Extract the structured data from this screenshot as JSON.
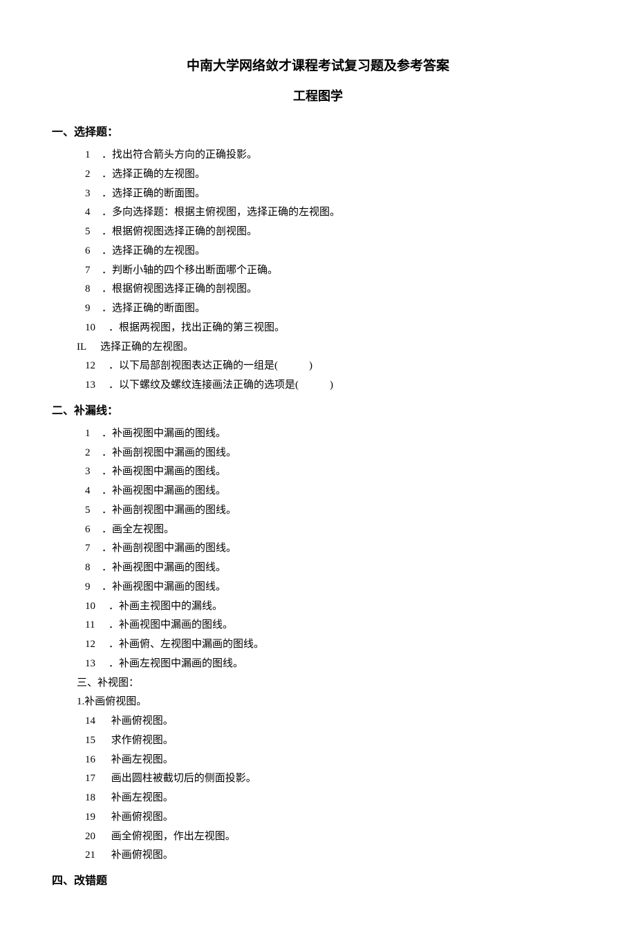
{
  "title": "中南大学网络敛才课程考试复习题及参考答案",
  "subtitle": "工程图学",
  "sections": [
    {
      "header": "一、选择题：",
      "items": [
        {
          "num": "1",
          "text": "．找出符合箭头方向的正确投影。"
        },
        {
          "num": "2",
          "text": "．选择正确的左视图。"
        },
        {
          "num": "3",
          "text": "．选择正确的断面图。"
        },
        {
          "num": "4",
          "text": "．多向选择题：根据主俯视图，选择正确的左视图。"
        },
        {
          "num": "5",
          "text": "．根据俯视图选择正确的剖视图。"
        },
        {
          "num": "6",
          "text": "．选择正确的左视图。"
        },
        {
          "num": "7",
          "text": "．判断小轴的四个移出断面哪个正确。"
        },
        {
          "num": "8",
          "text": "．根据俯视图选择正确的剖视图。"
        },
        {
          "num": "9",
          "text": "．选择正确的断面图。"
        },
        {
          "num": "10",
          "text": "．根据两视图，找出正确的第三视图。"
        },
        {
          "num": "IL",
          "text": "选择正确的左视图。",
          "alt": true
        },
        {
          "num": "12",
          "text": "．以下局部剖视图表达正确的一组是(　　　)"
        },
        {
          "num": "13",
          "text": "．以下螺纹及螺纹连接画法正确的选项是(　　　)"
        }
      ]
    },
    {
      "header": "二、补漏线：",
      "items": [
        {
          "num": "1",
          "text": "．补画视图中漏画的图线。"
        },
        {
          "num": "2",
          "text": "．补画剖视图中漏画的图线。"
        },
        {
          "num": "3",
          "text": "．补画视图中漏画的图线。"
        },
        {
          "num": "4",
          "text": "．补画视图中漏画的图线。"
        },
        {
          "num": "5",
          "text": "．补画剖视图中漏画的图线。"
        },
        {
          "num": "6",
          "text": "．画全左视图。"
        },
        {
          "num": "7",
          "text": "．补画剖视图中漏画的图线。"
        },
        {
          "num": "8",
          "text": "．补画视图中漏画的图线。"
        },
        {
          "num": "9",
          "text": "．补画视图中漏画的图线。"
        },
        {
          "num": "10",
          "text": "．补画主视图中的漏线。"
        },
        {
          "num": "11",
          "text": "．补画视图中漏画的图线。"
        },
        {
          "num": "12",
          "text": "．补画俯、左视图中漏画的图线。"
        },
        {
          "num": "13",
          "text": "．补画左视图中漏画的图线。"
        },
        {
          "num": "",
          "text": "三、补视图：",
          "alt": true
        },
        {
          "num": "",
          "text": "1.补画俯视图。",
          "alt": true
        },
        {
          "num": "14",
          "text": " 补画俯视图。"
        },
        {
          "num": "15",
          "text": " 求作俯视图。"
        },
        {
          "num": "16",
          "text": " 补画左视图。"
        },
        {
          "num": "17",
          "text": " 画出圆柱被截切后的侧面投影。"
        },
        {
          "num": "18",
          "text": " 补画左视图。"
        },
        {
          "num": "19",
          "text": " 补画俯视图。"
        },
        {
          "num": "20",
          "text": " 画全俯视图，作出左视图。"
        },
        {
          "num": "21",
          "text": " 补画俯视图。"
        }
      ]
    },
    {
      "header": "四、改错题",
      "items": []
    }
  ]
}
